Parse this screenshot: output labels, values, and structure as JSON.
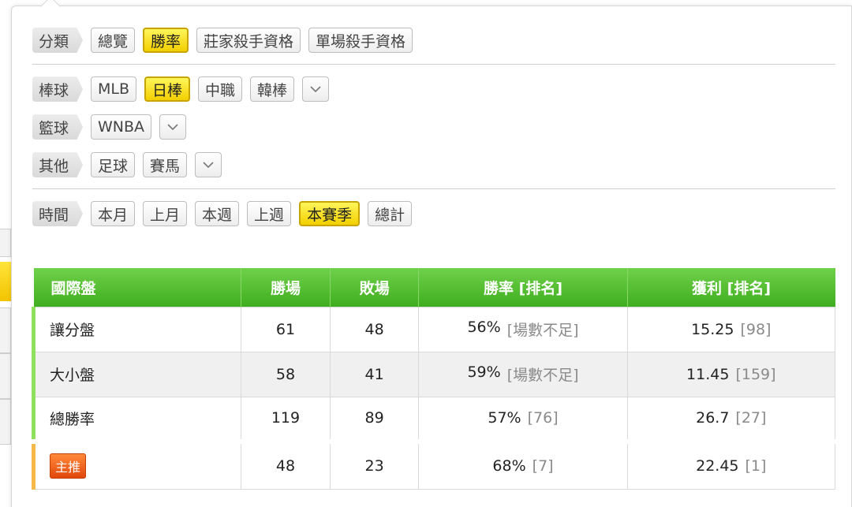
{
  "filters": {
    "category": {
      "label": "分類",
      "options": [
        "總覽",
        "勝率",
        "莊家殺手資格",
        "單場殺手資格"
      ],
      "selected": "勝率"
    },
    "baseball": {
      "label": "棒球",
      "options": [
        "MLB",
        "日棒",
        "中職",
        "韓棒"
      ],
      "selected": "日棒"
    },
    "basketball": {
      "label": "籃球",
      "options": [
        "WNBA"
      ]
    },
    "other": {
      "label": "其他",
      "options": [
        "足球",
        "賽馬"
      ]
    },
    "time": {
      "label": "時間",
      "options": [
        "本月",
        "上月",
        "本週",
        "上週",
        "本賽季",
        "總計"
      ],
      "selected": "本賽季"
    }
  },
  "table": {
    "headers": [
      "國際盤",
      "勝場",
      "敗場",
      "勝率 [排名]",
      "獲利 [排名]"
    ],
    "rows": [
      {
        "name": "讓分盤",
        "wins": "61",
        "losses": "48",
        "rate": "56%",
        "rate_rank": "[場數不足]",
        "profit": "15.25",
        "profit_rank": "[98]"
      },
      {
        "name": "大小盤",
        "wins": "58",
        "losses": "41",
        "rate": "59%",
        "rate_rank": "[場數不足]",
        "profit": "11.45",
        "profit_rank": "[159]"
      },
      {
        "name": "總勝率",
        "wins": "119",
        "losses": "89",
        "rate": "57%",
        "rate_rank": "[76]",
        "profit": "26.7",
        "profit_rank": "[27]"
      }
    ],
    "special_row": {
      "badge": "主推",
      "wins": "48",
      "losses": "23",
      "rate": "68%",
      "rate_rank": "[7]",
      "profit": "22.45",
      "profit_rank": "[1]"
    }
  },
  "colors": {
    "accent_yellow": "#f3cf00",
    "header_green": "#3fad1f",
    "badge_orange": "#e2470c"
  }
}
